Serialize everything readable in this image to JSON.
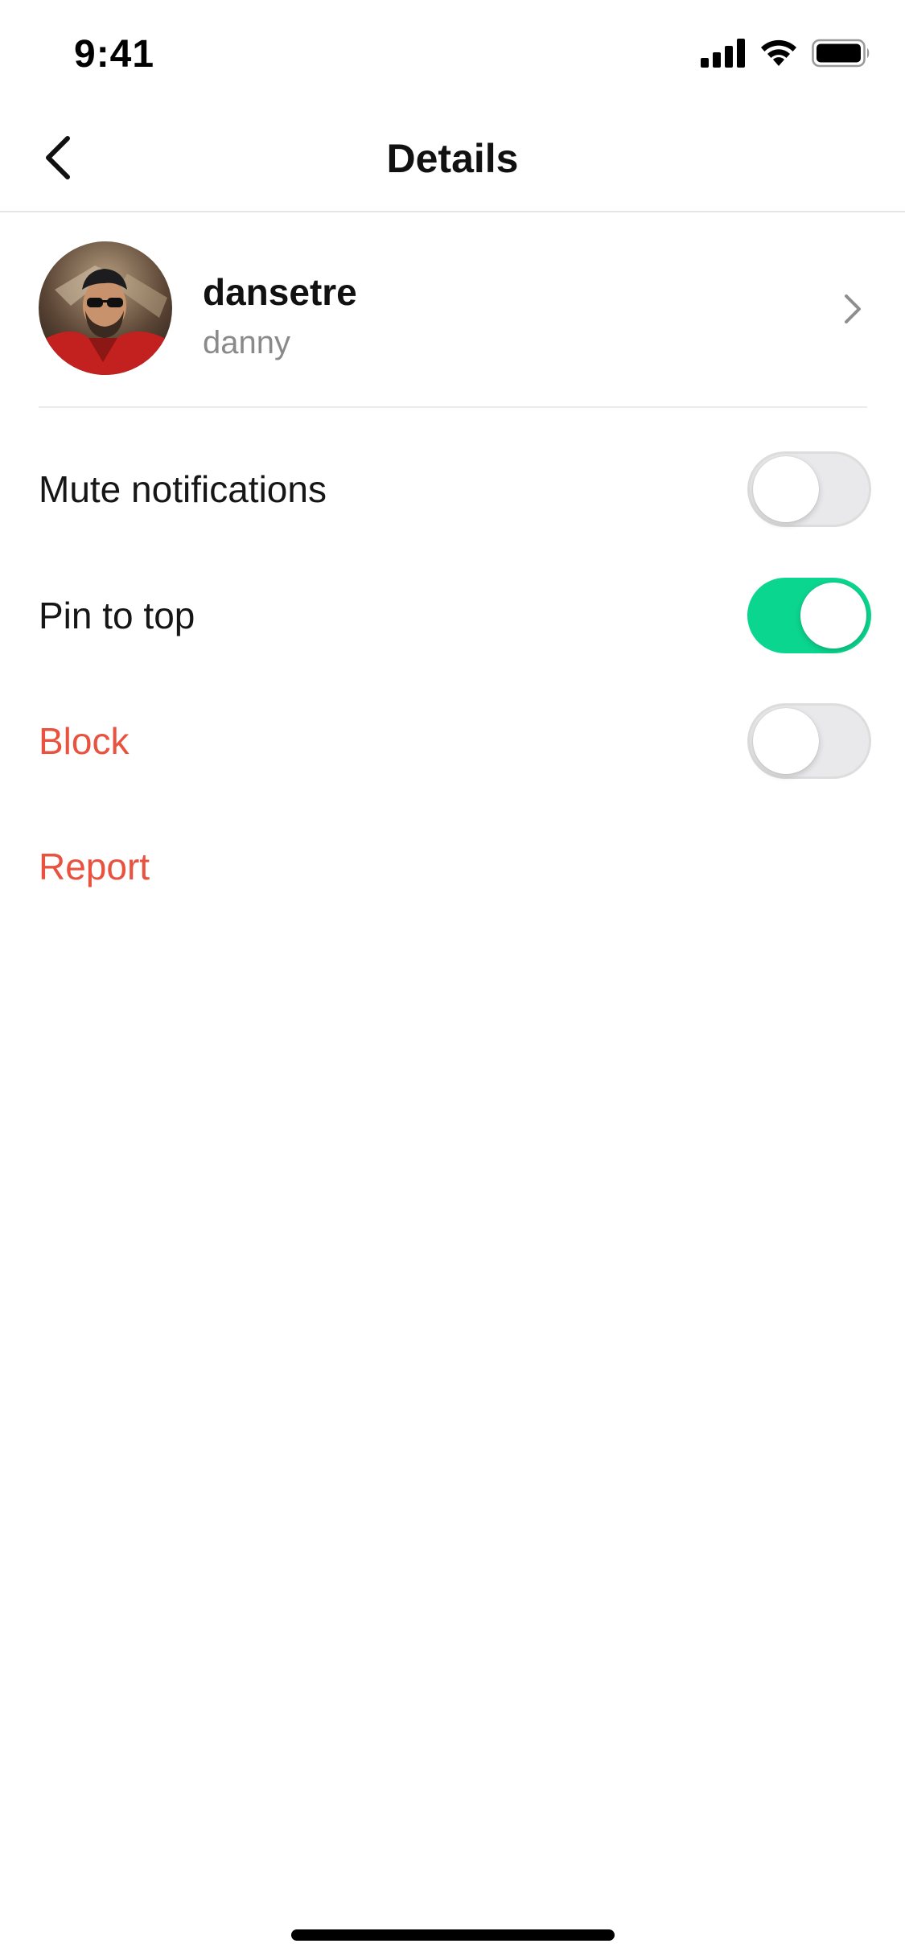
{
  "status_bar": {
    "time": "9:41",
    "icons": [
      "cellular-signal-icon",
      "wifi-icon",
      "battery-icon"
    ]
  },
  "nav": {
    "title": "Details",
    "back_icon": "chevron-left-icon"
  },
  "profile": {
    "name": "dansetre",
    "handle": "danny",
    "chevron_icon": "chevron-right-icon"
  },
  "settings": [
    {
      "label": "Mute notifications",
      "toggle": false,
      "style": "normal"
    },
    {
      "label": "Pin to top",
      "toggle": true,
      "style": "normal"
    },
    {
      "label": "Block",
      "toggle": false,
      "style": "danger"
    },
    {
      "label": "Report",
      "style": "danger"
    }
  ],
  "colors": {
    "accent_green": "#0BD68F",
    "danger_red": "#E8523F",
    "secondary_text": "#8A8A8A"
  }
}
